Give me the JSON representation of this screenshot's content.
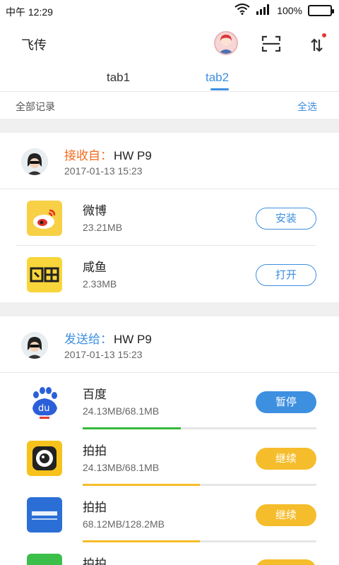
{
  "status_bar": {
    "time": "中午 12:29",
    "battery": "100%",
    "icons": [
      "wifi-icon",
      "signal-icon",
      "battery-icon"
    ]
  },
  "app_bar": {
    "title": "飞传",
    "icons": [
      "user-avatar-icon",
      "scan-icon",
      "transfer-icon"
    ]
  },
  "tabs": [
    {
      "label": "tab1",
      "active": false
    },
    {
      "label": "tab2",
      "active": true
    }
  ],
  "records": {
    "label": "全部记录",
    "select_all": "全选"
  },
  "groups": [
    {
      "direction": "接收自：",
      "device": "HW P9",
      "date": "2017-01-13 15:23",
      "files": [
        {
          "name": "微博",
          "size": "23.21MB",
          "action": "安装",
          "icon": "weibo-icon"
        },
        {
          "name": "咸鱼",
          "size": "2.33MB",
          "action": "打开",
          "icon": "xianyu-icon"
        }
      ]
    },
    {
      "direction": "发送给：",
      "device": "HW P9",
      "date": "2017-01-13 15:23",
      "files": [
        {
          "name": "百度",
          "size": "24.13MB/68.1MB",
          "action": "暂停",
          "icon": "baidu-icon",
          "progress": 0.42
        },
        {
          "name": "拍拍",
          "size": "24.13MB/68.1MB",
          "action": "继续",
          "icon": "paipai-icon",
          "progress": 0.5
        },
        {
          "name": "拍拍",
          "size": "68.12MB/128.2MB",
          "action": "继续",
          "icon": "autohome-icon",
          "progress": 0.5
        },
        {
          "name": "拍拍",
          "size": "",
          "action": "",
          "icon": "app-icon"
        }
      ]
    }
  ],
  "colors": {
    "accent_blue": "#3d8fe0",
    "receive_orange": "#f26a1b",
    "progress_green": "#35b83c",
    "progress_yellow": "#f5bd2b"
  }
}
